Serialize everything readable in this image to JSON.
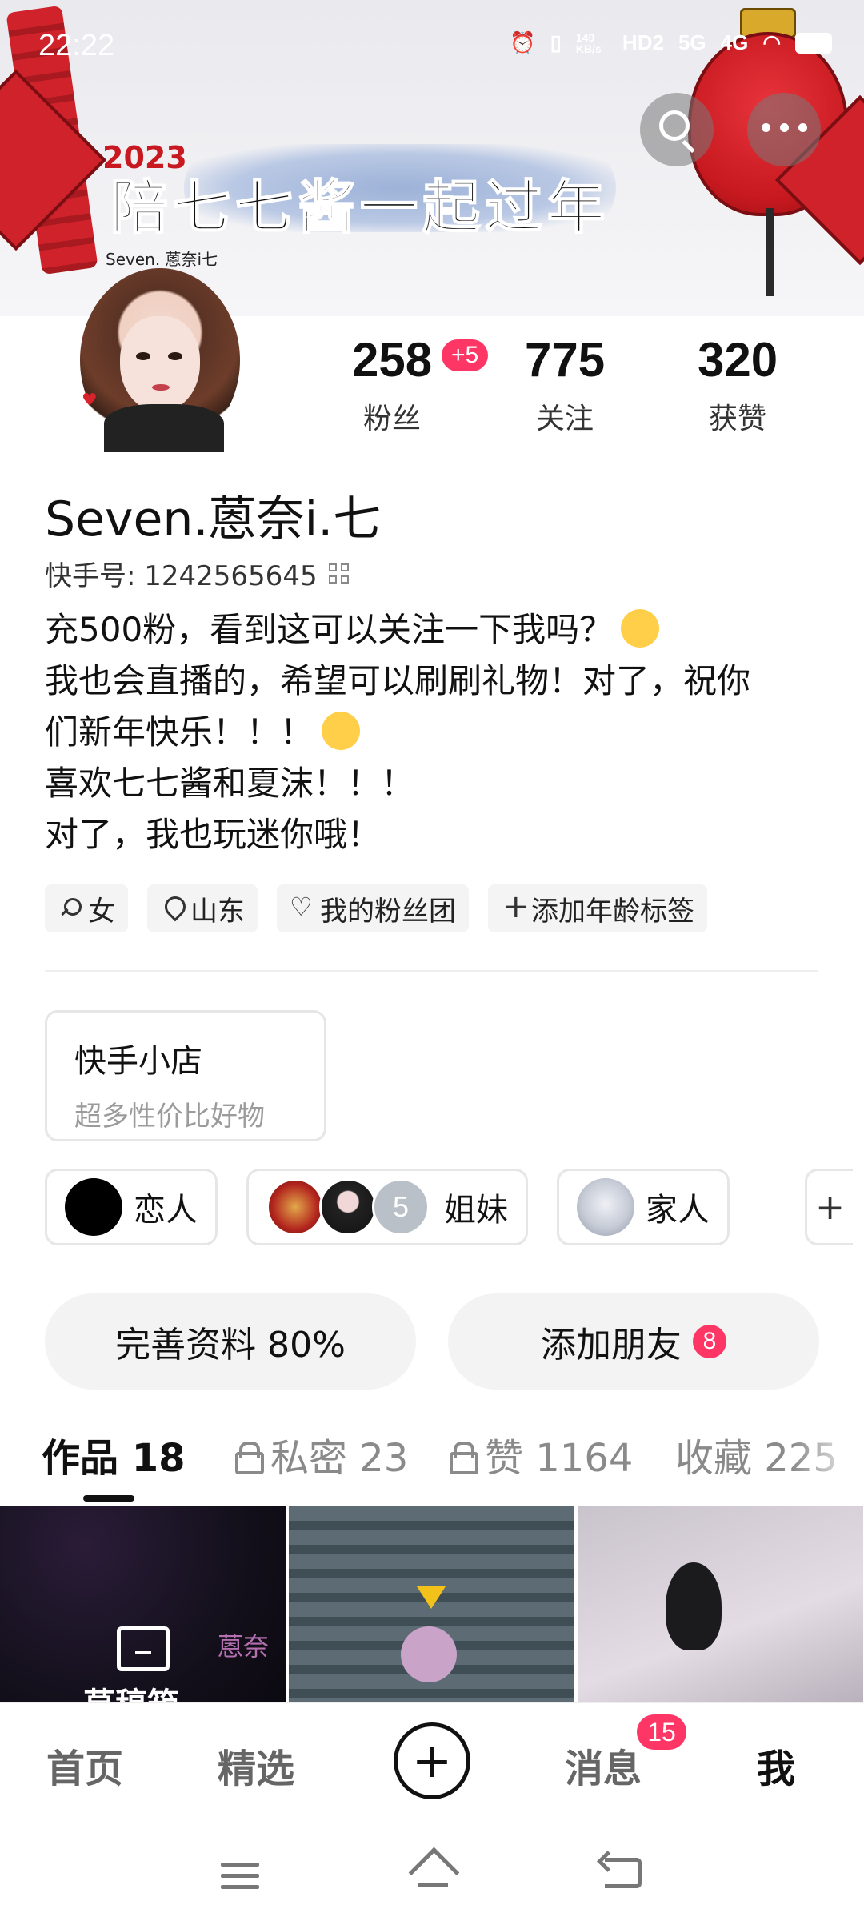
{
  "status_bar": {
    "time": "22:22",
    "net_speed": "149 KB/s",
    "indicators": [
      "alarm-icon",
      "vibrate-icon",
      "hd-icon",
      "5g-signal-icon",
      "4g-signal-icon",
      "wifi-icon",
      "battery-icon"
    ],
    "hd_label": "HD2",
    "net_5g": "5G",
    "net_4g": "4G"
  },
  "banner": {
    "year": "2023",
    "title": "陪七七酱一起过年",
    "caption": "Seven. 蒽奈i七",
    "accent_color": "#c7191f"
  },
  "profile": {
    "stats": [
      {
        "value": "258",
        "label": "粉丝"
      },
      {
        "value": "775",
        "label": "关注"
      },
      {
        "value": "320",
        "label": "获赞"
      }
    ],
    "fans_increase": "+5",
    "nickname": "Seven.蒽奈i.七",
    "kuaishou_id": "快手号: 1242565645",
    "bio_lines": [
      "充500粉，看到这可以关注一下我吗？",
      "我也会直播的，希望可以刷刷礼物！对了，祝你",
      "们新年快乐！！！",
      "喜欢七七酱和夏沫！！！",
      "对了，我也玩迷你哦！"
    ],
    "tags": [
      {
        "icon": "female-icon",
        "label": "女"
      },
      {
        "icon": "location-pin-icon",
        "label": "山东"
      },
      {
        "icon": "heart-icon",
        "label": "我的粉丝团"
      },
      {
        "icon": "plus-icon",
        "label": "添加年龄标签"
      }
    ]
  },
  "shop": {
    "title": "快手小店",
    "subtitle": "超多性价比好物"
  },
  "relations": [
    {
      "label": "恋人"
    },
    {
      "label": "姐妹",
      "extra_count": "5"
    },
    {
      "label": "家人"
    },
    {
      "label": "+"
    }
  ],
  "actions": {
    "complete_profile": "完善资料 80%",
    "add_friend": "添加朋友",
    "add_friend_count": "8"
  },
  "tabs": [
    {
      "label": "作品 18",
      "active": true
    },
    {
      "label": "私密 23",
      "locked": true
    },
    {
      "label": "赞 1164",
      "locked": true
    },
    {
      "label": "收藏 225"
    }
  ],
  "grid": {
    "draft_label": "草稿箱",
    "watermark": "蒽奈"
  },
  "bottom_nav": {
    "home": "首页",
    "featured": "精选",
    "add": "+",
    "messages": "消息",
    "messages_badge": "15",
    "me": "我",
    "badge_color": "#fe3666"
  }
}
